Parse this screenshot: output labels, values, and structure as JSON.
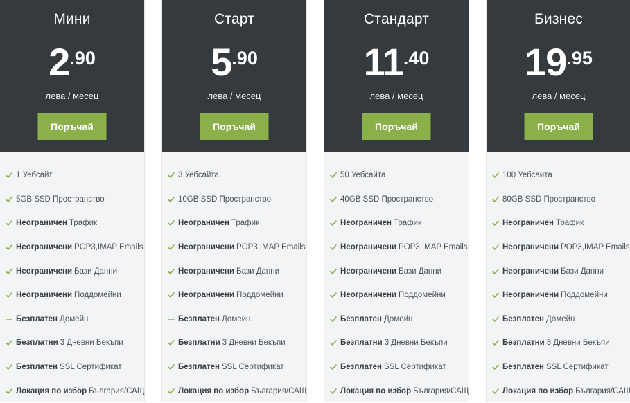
{
  "colors": {
    "header_bg": "#353a3f",
    "body_bg": "#f3f4f5",
    "accent": "#8bb04a",
    "text": "#4c5257"
  },
  "plans": [
    {
      "name": "Мини",
      "price_int": "2",
      "price_dec": ".90",
      "period": "лева / месец",
      "button": "Поръчай",
      "features": [
        {
          "bold": "",
          "text": "1 Уебсайт",
          "icon": "check-icon"
        },
        {
          "bold": "",
          "text": "5GB SSD Пространство",
          "icon": "check-icon"
        },
        {
          "bold": "Неограничен",
          "text": "Трафик",
          "icon": "check-icon"
        },
        {
          "bold": "Неограничени",
          "text": "POP3,IMAP Emails",
          "icon": "check-icon"
        },
        {
          "bold": "Неограничени",
          "text": "Бази Данни",
          "icon": "check-icon"
        },
        {
          "bold": "Неограничени",
          "text": "Поддомейни",
          "icon": "check-icon"
        },
        {
          "bold": "Безплатен",
          "text": "Домейн",
          "icon": "dash-icon"
        },
        {
          "bold": "Безплатни",
          "text": "3 Дневни Бекъпи",
          "icon": "check-icon"
        },
        {
          "bold": "Безплатен",
          "text": "SSL Сертификат",
          "icon": "check-icon"
        },
        {
          "bold": "Локация по избор",
          "text": "България/САЩ",
          "icon": "check-icon"
        }
      ]
    },
    {
      "name": "Старт",
      "price_int": "5",
      "price_dec": ".90",
      "period": "лева / месец",
      "button": "Поръчай",
      "features": [
        {
          "bold": "",
          "text": "3 Уебсайта",
          "icon": "check-icon"
        },
        {
          "bold": "",
          "text": "10GB SSD Пространство",
          "icon": "check-icon"
        },
        {
          "bold": "Неограничен",
          "text": "Трафик",
          "icon": "check-icon"
        },
        {
          "bold": "Неограничени",
          "text": "POP3,IMAP Emails",
          "icon": "check-icon"
        },
        {
          "bold": "Неограничени",
          "text": "Бази Данни",
          "icon": "check-icon"
        },
        {
          "bold": "Неограничени",
          "text": "Поддомейни",
          "icon": "check-icon"
        },
        {
          "bold": "Безплатен",
          "text": "Домейн",
          "icon": "dash-icon"
        },
        {
          "bold": "Безплатни",
          "text": "3 Дневни Бекъпи",
          "icon": "check-icon"
        },
        {
          "bold": "Безплатен",
          "text": "SSL Сертификат",
          "icon": "check-icon"
        },
        {
          "bold": "Локация по избор",
          "text": "България/САЩ",
          "icon": "check-icon"
        }
      ]
    },
    {
      "name": "Стандарт",
      "price_int": "11",
      "price_dec": ".40",
      "period": "лева / месец",
      "button": "Поръчай",
      "features": [
        {
          "bold": "",
          "text": "50 Уебсайта",
          "icon": "check-icon"
        },
        {
          "bold": "",
          "text": "40GB SSD Пространство",
          "icon": "check-icon"
        },
        {
          "bold": "Неограничен",
          "text": "Трафик",
          "icon": "check-icon"
        },
        {
          "bold": "Неограничени",
          "text": "POP3,IMAP Emails",
          "icon": "check-icon"
        },
        {
          "bold": "Неограничени",
          "text": "Бази Данни",
          "icon": "check-icon"
        },
        {
          "bold": "Неограничени",
          "text": "Поддомейни",
          "icon": "check-icon"
        },
        {
          "bold": "Безплатен",
          "text": "Домейн",
          "icon": "check-icon"
        },
        {
          "bold": "Безплатни",
          "text": "3 Дневни Бекъпи",
          "icon": "check-icon"
        },
        {
          "bold": "Безплатен",
          "text": "SSL Сертификат",
          "icon": "check-icon"
        },
        {
          "bold": "Локация по избор",
          "text": "България/САЩ",
          "icon": "check-icon"
        }
      ]
    },
    {
      "name": "Бизнес",
      "price_int": "19",
      "price_dec": ".95",
      "period": "лева / месец",
      "button": "Поръчай",
      "features": [
        {
          "bold": "",
          "text": "100 Уебсайта",
          "icon": "check-icon"
        },
        {
          "bold": "",
          "text": "80GB SSD Пространство",
          "icon": "check-icon"
        },
        {
          "bold": "Неограничен",
          "text": "Трафик",
          "icon": "check-icon"
        },
        {
          "bold": "Неограничени",
          "text": "POP3,IMAP Emails",
          "icon": "check-icon"
        },
        {
          "bold": "Неограничени",
          "text": "Бази Данни",
          "icon": "check-icon"
        },
        {
          "bold": "Неограничени",
          "text": "Поддомейни",
          "icon": "check-icon"
        },
        {
          "bold": "Безплатен",
          "text": "Домейн",
          "icon": "check-icon"
        },
        {
          "bold": "Безплатни",
          "text": "3 Дневни Бекъпи",
          "icon": "check-icon"
        },
        {
          "bold": "Безплатен",
          "text": "SSL Сертификат",
          "icon": "check-icon"
        },
        {
          "bold": "Локация по избор",
          "text": "България/САЩ",
          "icon": "check-icon"
        }
      ]
    }
  ]
}
